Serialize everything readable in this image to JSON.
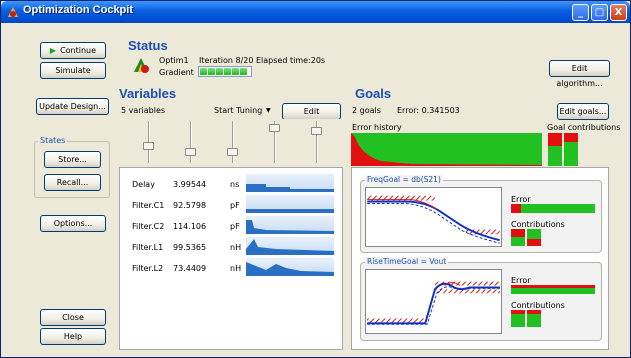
{
  "window": {
    "title": "Optimization Cockpit",
    "minimize": "_",
    "maximize": "□",
    "close": "X"
  },
  "left_buttons": {
    "continue": "Continue",
    "simulate": "Simulate",
    "update_design": "Update Design...",
    "options": "Options...",
    "close": "Close",
    "help": "Help"
  },
  "states": {
    "label": "States",
    "store": "Store...",
    "recall": "Recall..."
  },
  "status": {
    "heading": "Status",
    "optim_name": "Optim1",
    "iteration": "Iteration 8/20",
    "elapsed": "Elapsed time:20s",
    "gradient_label": "Gradient",
    "gradient_blocks": 6,
    "edit_algorithm": "Edit algorithm..."
  },
  "variables": {
    "heading": "Variables",
    "count": "5 variables",
    "start_tuning": "Start Tuning",
    "edit_variables": "Edit variables...",
    "slider_levels": [
      0.38,
      0.2,
      0.22,
      0.9,
      0.82
    ],
    "rows": [
      {
        "name": "Delay",
        "value": "3.99544",
        "unit": "ns"
      },
      {
        "name": "Filter.C1",
        "value": "92.5798",
        "unit": "pF"
      },
      {
        "name": "Filter.C2",
        "value": "114.106",
        "unit": "pF"
      },
      {
        "name": "Filter.L1",
        "value": "99.5365",
        "unit": "nH"
      },
      {
        "name": "Filter.L2",
        "value": "73.4409",
        "unit": "nH"
      }
    ]
  },
  "goals": {
    "heading": "Goals",
    "count": "2 goals",
    "error": "Error: 0.341503",
    "edit_goals": "Edit goals...",
    "error_history": "Error history",
    "goal_contributions": "Goal contributions",
    "goal_list": [
      {
        "title": "FreqGoal = db(S21)",
        "error_label": "Error",
        "contributions_label": "Contributions"
      },
      {
        "title": "RiseTimeGoal = Vout",
        "error_label": "Error",
        "contributions_label": "Contributions"
      }
    ]
  },
  "colors": {
    "heading_blue": "#1f4fb3",
    "red": "#e01010",
    "green": "#22c020",
    "navy": "#0a246a"
  }
}
